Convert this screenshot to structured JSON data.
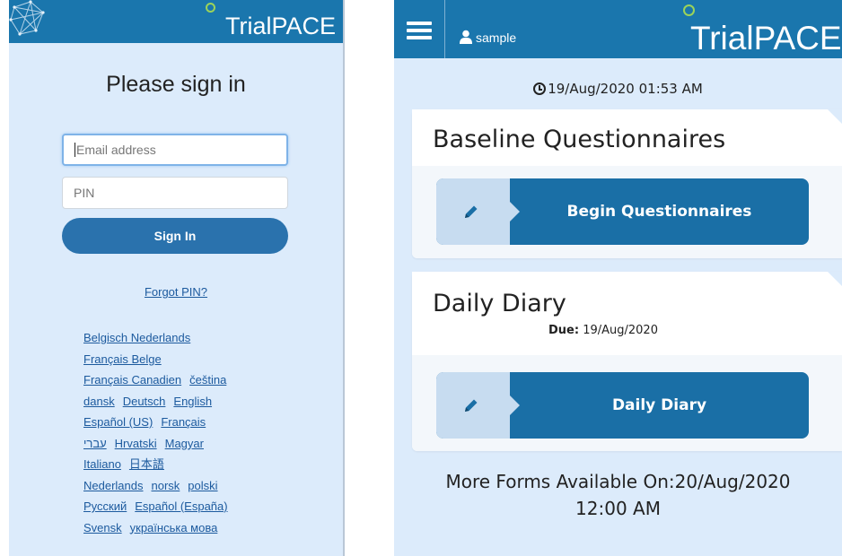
{
  "signin": {
    "logo": "TrialPACE",
    "title": "Please sign in",
    "email_placeholder": "Email address",
    "pin_placeholder": "PIN",
    "signin_label": "Sign In",
    "forgot_pin": "Forgot PIN?",
    "languages": [
      [
        "Belgisch Nederlands"
      ],
      [
        "Français Belge"
      ],
      [
        "Français Canadien",
        "čeština"
      ],
      [
        "dansk",
        "Deutsch",
        "English"
      ],
      [
        "Español (US)",
        "Français"
      ],
      [
        "עברי",
        "Hrvatski",
        "Magyar"
      ],
      [
        "Italiano",
        "日本語"
      ],
      [
        "Nederlands",
        "norsk",
        "polski"
      ],
      [
        "Русский",
        "Español (España)"
      ],
      [
        "Svensk",
        "українська мова"
      ]
    ]
  },
  "dashboard": {
    "logo": "TrialPACE",
    "user": "sample",
    "timestamp": "19/Aug/2020 01:53 AM",
    "baseline": {
      "title": "Baseline Questionnaires",
      "button_label": "Begin Questionnaires"
    },
    "diary": {
      "title": "Daily Diary",
      "due_label": "Due:",
      "due_date": " 19/Aug/2020",
      "button_label": "Daily Diary"
    },
    "more_forms_line1": "More Forms Available On:20/Aug/2020",
    "more_forms_line2": "12:00 AM"
  },
  "colors": {
    "header": "#1a76ad",
    "background": "#dcebfb",
    "button": "#1a6fa6",
    "link": "#1c5a9e",
    "logo_accent": "#9bd35a"
  },
  "icons": [
    "network-mesh-icon",
    "logo-dot-icon",
    "menu-icon",
    "user-icon",
    "clock-icon",
    "pencil-icon"
  ]
}
